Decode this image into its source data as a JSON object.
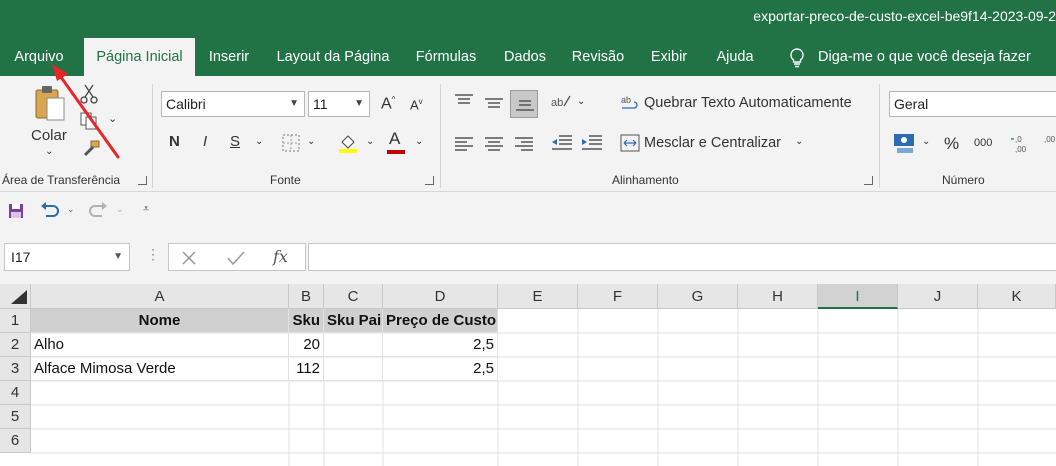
{
  "window": {
    "title": "exportar-preco-de-custo-excel-be9f14-2023-09-2"
  },
  "tabs": [
    "Arquivo",
    "Página Inicial",
    "Inserir",
    "Layout da Página",
    "Fórmulas",
    "Dados",
    "Revisão",
    "Exibir",
    "Ajuda"
  ],
  "tell_me": "Diga-me o que você deseja fazer",
  "ribbon": {
    "clipboard": {
      "paste_label": "Colar",
      "group_label": "Área de Transferência"
    },
    "font": {
      "font_name": "Calibri",
      "font_size": "11",
      "bold": "N",
      "italic": "I",
      "underline": "S",
      "grow": "A",
      "shrink": "A",
      "font_color_letter": "A",
      "group_label": "Fonte",
      "highlight_color": "#ffff00",
      "font_color": "#c00000"
    },
    "alignment": {
      "wrap_text": "Quebrar Texto Automaticamente",
      "merge_center": "Mesclar e Centralizar",
      "group_label": "Alinhamento"
    },
    "number": {
      "format": "Geral",
      "percent": "%",
      "comma": "000",
      "group_label": "Número"
    }
  },
  "formula_bar": {
    "name_box": "I17",
    "fx": "fx",
    "value": ""
  },
  "columns": [
    "A",
    "B",
    "C",
    "D",
    "E",
    "F",
    "G",
    "H",
    "I",
    "J",
    "K"
  ],
  "selected_column": "I",
  "rows": [
    "1",
    "2",
    "3",
    "4",
    "5",
    "6"
  ],
  "cells": {
    "r1": [
      "Nome",
      "Sku",
      "Sku Pai",
      "Preço de Custo"
    ],
    "r2": [
      "Alho",
      "20",
      "",
      "2,5"
    ],
    "r3": [
      "Alface Mimosa Verde",
      "112",
      "",
      "2,5"
    ]
  },
  "colors": {
    "accent": "#217346",
    "annotation_arrow": "#e8262a"
  }
}
